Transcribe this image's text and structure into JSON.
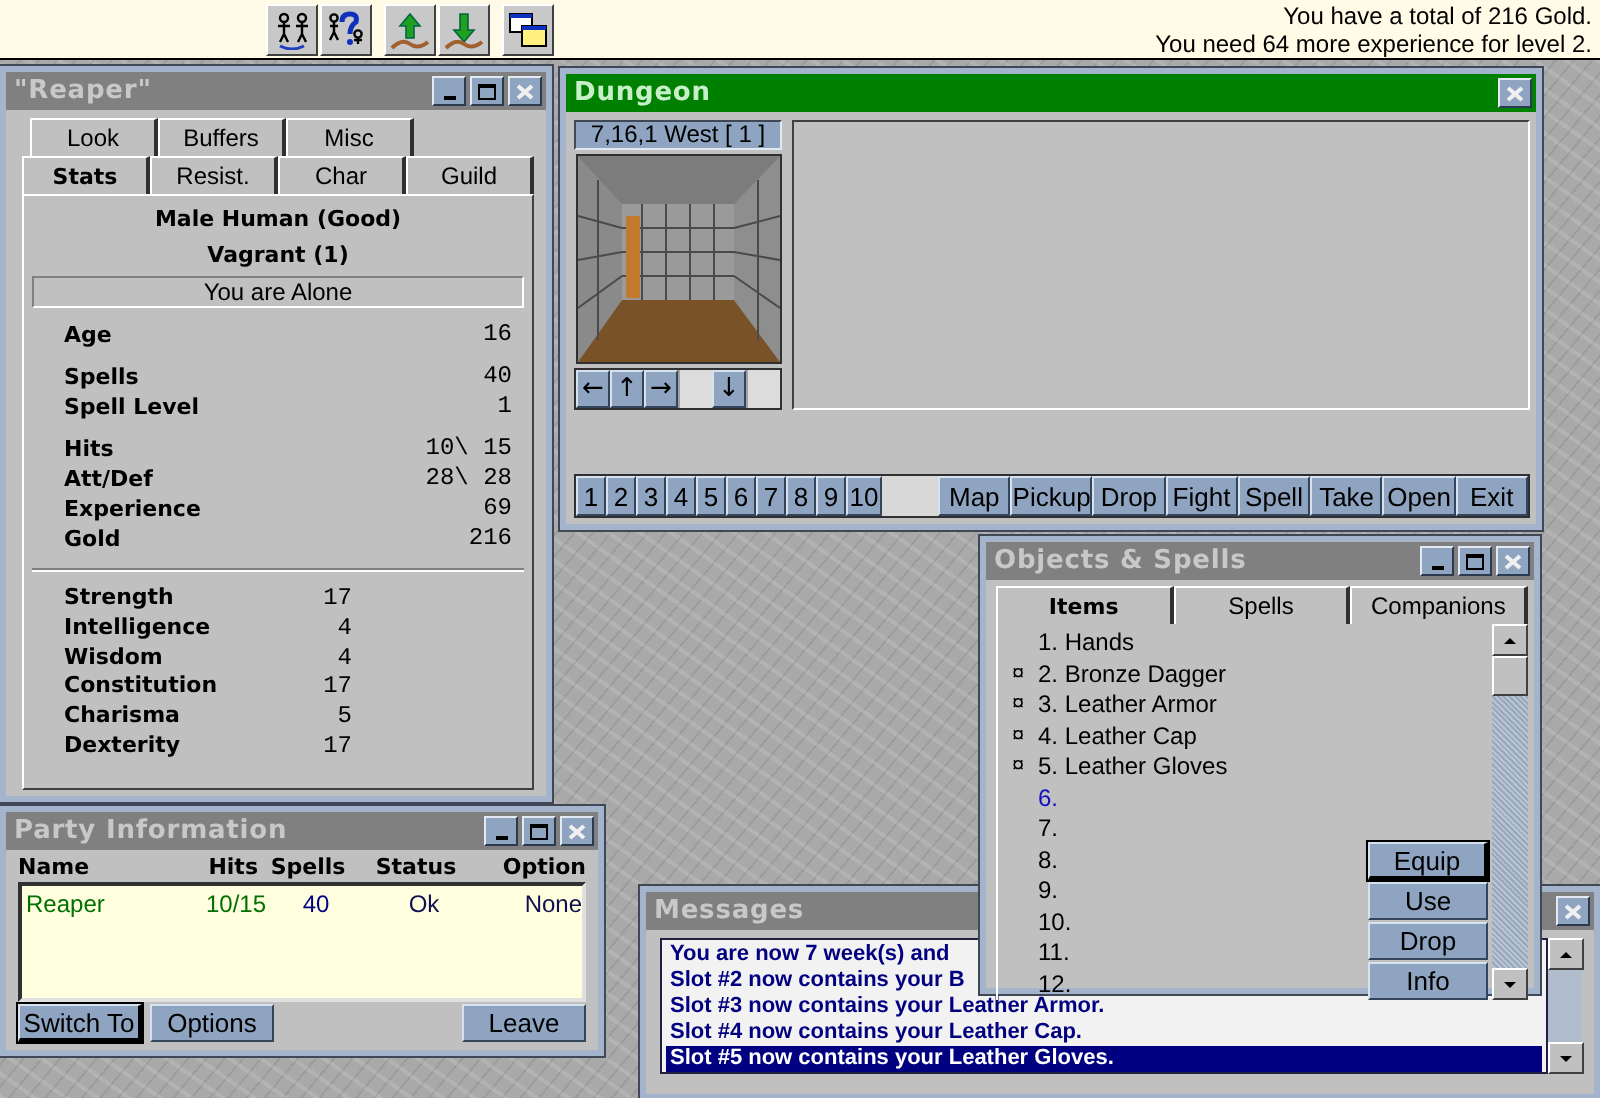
{
  "status_lines": [
    "You have a total of 216 Gold.",
    "You need 64 more experience for level 2."
  ],
  "character_window": {
    "title": "\"Reaper\"",
    "active": false,
    "controls": [
      {
        "kind": "minimize"
      },
      {
        "kind": "maximize"
      },
      {
        "kind": "close"
      }
    ],
    "tabs_back": [
      {
        "label": "Look",
        "selected": false
      },
      {
        "label": "Buffers",
        "selected": false
      },
      {
        "label": "Misc",
        "selected": false
      }
    ],
    "tabs_front": [
      {
        "label": "Stats",
        "selected": true
      },
      {
        "label": "Resist.",
        "selected": false
      },
      {
        "label": "Char",
        "selected": false
      },
      {
        "label": "Guild",
        "selected": false
      }
    ],
    "race": "Male Human (Good)",
    "class": "Vagrant (1)",
    "party_status": "You are Alone",
    "stat_groups": [
      [
        {
          "label": "Age",
          "value": "16"
        }
      ],
      [
        {
          "label": "Spells",
          "value": "40"
        },
        {
          "label": "Spell Level",
          "value": "1"
        }
      ],
      [
        {
          "label": "Hits",
          "value": "10\\ 15"
        },
        {
          "label": "Att/Def",
          "value": "28\\ 28"
        },
        {
          "label": "Experience",
          "value": "69"
        },
        {
          "label": "Gold",
          "value": "216"
        }
      ]
    ],
    "attributes": [
      {
        "label": "Strength",
        "value": "17"
      },
      {
        "label": "Intelligence",
        "value": "4"
      },
      {
        "label": "Wisdom",
        "value": "4"
      },
      {
        "label": "Constitution",
        "value": "17"
      },
      {
        "label": "Charisma",
        "value": "5"
      },
      {
        "label": "Dexterity",
        "value": "17"
      }
    ]
  },
  "dungeon_window": {
    "title": "Dungeon",
    "active": true,
    "controls": [
      {
        "kind": "close"
      }
    ],
    "location": "7,16,1 West [ 1 ]",
    "moves": [
      {
        "kind": "button",
        "label": "←"
      },
      {
        "kind": "button",
        "label": "↑"
      },
      {
        "kind": "button",
        "label": "→"
      },
      {
        "kind": "blank"
      },
      {
        "kind": "button",
        "label": "↓"
      },
      {
        "kind": "blank"
      }
    ],
    "number_buttons": [
      "1",
      "2",
      "3",
      "4",
      "5",
      "6",
      "7",
      "8",
      "9",
      "10"
    ],
    "action_buttons": [
      "Map",
      "Pickup",
      "Drop",
      "Fight",
      "Spell",
      "Take",
      "Open",
      "Exit"
    ]
  },
  "party_window": {
    "title": "Party Information",
    "active": false,
    "controls": [
      {
        "kind": "minimize"
      },
      {
        "kind": "maximize"
      },
      {
        "kind": "close"
      }
    ],
    "columns": [
      "Name",
      "Hits",
      "Spells",
      "Status",
      "Option"
    ],
    "rows": [
      {
        "cells": [
          "Reaper",
          "10/15",
          "40",
          "Ok",
          "None"
        ]
      }
    ],
    "buttons": [
      {
        "label": "Switch To",
        "default": true
      },
      {
        "label": "Options",
        "default": false
      },
      {
        "label": "Leave",
        "default": false
      }
    ]
  },
  "messages_window": {
    "title": "Messages",
    "active": false,
    "controls": [
      {
        "kind": "close"
      }
    ],
    "lines": [
      {
        "text": "You are now 7 week(s) and",
        "selected": false
      },
      {
        "text": "Slot #2 now contains your B",
        "selected": false
      },
      {
        "text": "Slot #3 now contains your Leather Armor.",
        "selected": false
      },
      {
        "text": "Slot #4 now contains your Leather Cap.",
        "selected": false
      },
      {
        "text": "Slot #5 now contains your Leather Gloves.",
        "selected": true
      }
    ]
  },
  "objects_window": {
    "title": "Objects & Spells",
    "active": false,
    "controls": [
      {
        "kind": "minimize"
      },
      {
        "kind": "maximize"
      },
      {
        "kind": "close"
      }
    ],
    "tabs": [
      {
        "label": "Items",
        "selected": true
      },
      {
        "label": "Spells",
        "selected": false
      },
      {
        "label": "Companions",
        "selected": false
      }
    ],
    "items": [
      {
        "text": "1. Hands",
        "selected": false
      },
      {
        "mark": "¤",
        "text": "2. Bronze Dagger",
        "selected": false
      },
      {
        "mark": "¤",
        "text": "3. Leather Armor",
        "selected": false
      },
      {
        "mark": "¤",
        "text": "4. Leather Cap",
        "selected": false
      },
      {
        "mark": "¤",
        "text": "5. Leather Gloves",
        "selected": false
      },
      {
        "text": "6.",
        "selected": true
      },
      {
        "text": "7.",
        "selected": false
      },
      {
        "text": "8.",
        "selected": false
      },
      {
        "text": "9.",
        "selected": false
      },
      {
        "text": "10.",
        "selected": false
      },
      {
        "text": "11.",
        "selected": false
      },
      {
        "text": "12.",
        "selected": false
      }
    ],
    "buttons": [
      {
        "label": "Equip",
        "default": true
      },
      {
        "label": "Use",
        "default": false
      },
      {
        "label": "Drop",
        "default": false
      },
      {
        "label": "Info",
        "default": false
      }
    ]
  }
}
